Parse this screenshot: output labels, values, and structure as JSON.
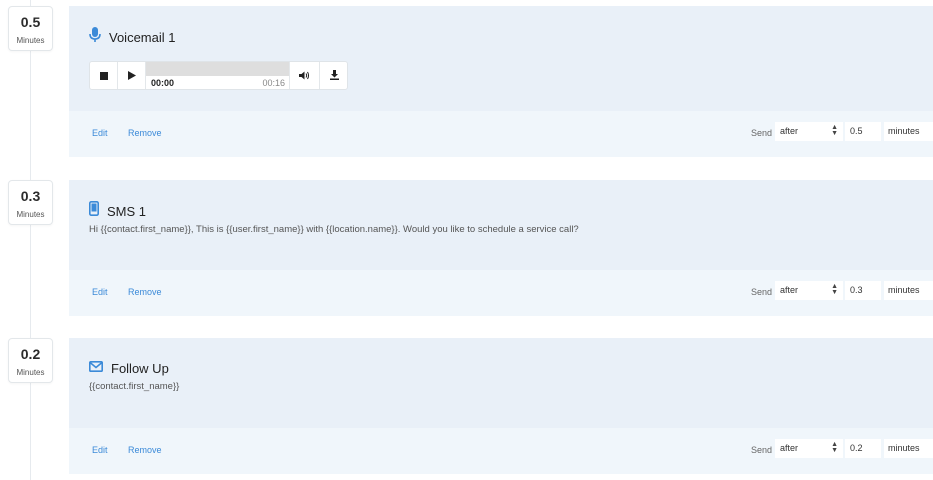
{
  "steps": [
    {
      "delay_value": "0.5",
      "delay_unit": "Minutes",
      "type": "voicemail",
      "icon": "microphone-icon",
      "title": "Voicemail 1",
      "player": {
        "current_time": "00:00",
        "total_time": "00:16"
      },
      "edit_label": "Edit",
      "remove_label": "Remove",
      "send_label": "Send",
      "send_when": "after",
      "send_amount": "0.5",
      "send_unit": "minutes"
    },
    {
      "delay_value": "0.3",
      "delay_unit": "Minutes",
      "type": "sms",
      "icon": "mobile-phone-icon",
      "title": "SMS 1",
      "body": "Hi {{contact.first_name}}, This is {{user.first_name}} with {{location.name}}. Would you like to schedule a service call?",
      "edit_label": "Edit",
      "remove_label": "Remove",
      "send_label": "Send",
      "send_when": "after",
      "send_amount": "0.3",
      "send_unit": "minutes"
    },
    {
      "delay_value": "0.2",
      "delay_unit": "Minutes",
      "type": "email",
      "icon": "envelope-icon",
      "title": "Follow Up",
      "body": "{{contact.first_name}}",
      "edit_label": "Edit",
      "remove_label": "Remove",
      "send_label": "Send",
      "send_when": "after",
      "send_amount": "0.2",
      "send_unit": "minutes"
    }
  ],
  "colors": {
    "accent": "#3b8ad8",
    "card_top": "#e9f0f8",
    "card_bottom": "#f0f6fb"
  }
}
